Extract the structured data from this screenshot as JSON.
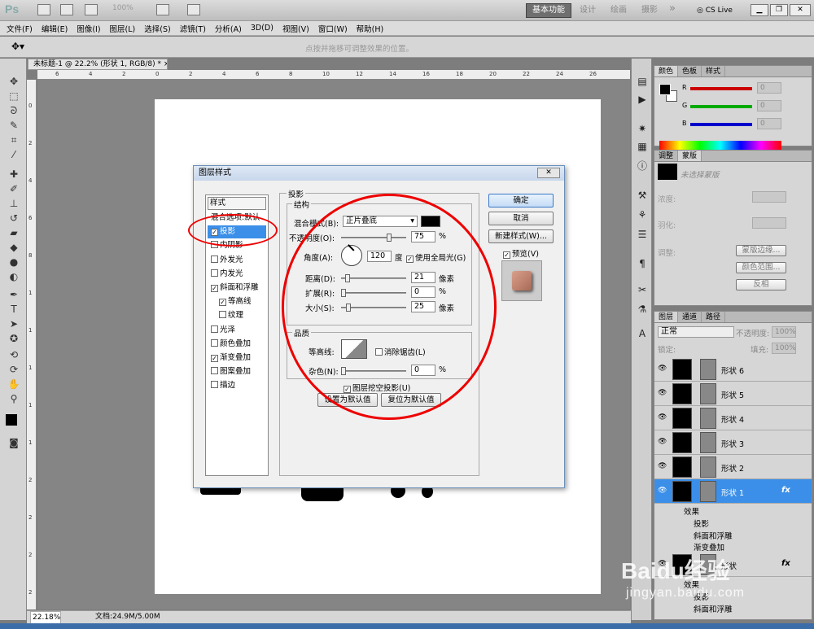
{
  "app": {
    "logo": "Ps",
    "zoom": "100%",
    "workspaces": [
      "基本功能",
      "设计",
      "绘画",
      "摄影"
    ],
    "more": "»",
    "cs_live": "CS Live"
  },
  "menu": [
    "文件(F)",
    "编辑(E)",
    "图像(I)",
    "图层(L)",
    "选择(S)",
    "滤镜(T)",
    "分析(A)",
    "3D(D)",
    "视图(V)",
    "窗口(W)",
    "帮助(H)"
  ],
  "options": {
    "hint": "点按并拖移可调整效果的位置。"
  },
  "doc_tab": "未标题-1 @ 22.2% (形状 1, RGB/8) *",
  "ruler_top": [
    "6",
    "4",
    "2",
    "0",
    "2",
    "4",
    "6",
    "8",
    "10",
    "12",
    "14",
    "16",
    "18",
    "20",
    "22",
    "24",
    "26"
  ],
  "ruler_left": [
    "0",
    "2",
    "4",
    "6",
    "8",
    "1",
    "1",
    "1",
    "1",
    "1",
    "2",
    "2",
    "2",
    "2"
  ],
  "status": {
    "zoom": "22.18%",
    "doc": "文档:24.9M/5.00M"
  },
  "color_panel": {
    "tabs": [
      "颜色",
      "色板",
      "样式"
    ],
    "r": "R",
    "g": "G",
    "b": "B",
    "r_val": "0",
    "g_val": "0",
    "b_val": "0"
  },
  "adjust_panel": {
    "tabs": [
      "调整",
      "蒙版"
    ],
    "mask_hint": "未选择蒙版",
    "density": "浓度:",
    "feather": "羽化:",
    "refine": "调整:",
    "btn_edge": "蒙版边缘...",
    "btn_range": "颜色范围...",
    "btn_invert": "反相"
  },
  "layers_panel": {
    "tabs": [
      "图层",
      "通道",
      "路径"
    ],
    "blend": "正常",
    "opacity_label": "不透明度:",
    "opacity": "100%",
    "lock": "锁定:",
    "fill_label": "填充:",
    "fill": "100%",
    "layers": [
      "形状 6",
      "形状 5",
      "形状 4",
      "形状 3",
      "形状 2",
      "形状 1"
    ],
    "fx": "fx",
    "effects_label": "效果",
    "effects": [
      "投影",
      "斜面和浮雕",
      "渐变叠加"
    ],
    "second_effects_label": "效果",
    "second_effects": [
      "投影",
      "斜面和浮雕"
    ],
    "second_layer": "形状"
  },
  "dialog": {
    "title": "图层样式",
    "styles_header": "样式",
    "styles": [
      {
        "label": "混合选项:默认",
        "check": false,
        "box": false
      },
      {
        "label": "投影",
        "check": true,
        "box": true
      },
      {
        "label": "内阴影",
        "check": false,
        "box": true
      },
      {
        "label": "外发光",
        "check": false,
        "box": true
      },
      {
        "label": "内发光",
        "check": false,
        "box": true
      },
      {
        "label": "斜面和浮雕",
        "check": true,
        "box": true
      },
      {
        "label": "等高线",
        "check": true,
        "box": true
      },
      {
        "label": "纹理",
        "check": false,
        "box": true
      },
      {
        "label": "光泽",
        "check": false,
        "box": true
      },
      {
        "label": "颜色叠加",
        "check": false,
        "box": true
      },
      {
        "label": "渐变叠加",
        "check": true,
        "box": true
      },
      {
        "label": "图案叠加",
        "check": false,
        "box": true
      },
      {
        "label": "描边",
        "check": false,
        "box": true
      }
    ],
    "section": "投影",
    "structure": "结构",
    "blend_mode_label": "混合模式(B):",
    "blend_mode": "正片叠底",
    "opacity_label": "不透明度(O):",
    "opacity": "75",
    "pct": "%",
    "angle_label": "角度(A):",
    "angle": "120",
    "deg": "度",
    "global_light": "使用全局光(G)",
    "distance_label": "距离(D):",
    "distance": "21",
    "spread_label": "扩展(R):",
    "spread": "0",
    "size_label": "大小(S):",
    "size": "25",
    "px": "像素",
    "quality": "品质",
    "contour_label": "等高线:",
    "antialias": "消除锯齿(L)",
    "noise_label": "杂色(N):",
    "noise": "0",
    "knockout": "图层挖空投影(U)",
    "set_default": "设置为默认值",
    "reset_default": "复位为默认值",
    "ok": "确定",
    "cancel": "取消",
    "new_style": "新建样式(W)...",
    "preview": "预览(V)",
    "sliders": {
      "opacity": 0.75,
      "distance": 0.07,
      "spread": 0.0,
      "size": 0.08,
      "noise": 0.0
    }
  },
  "watermark": {
    "brand": "Baidu经验",
    "url": "jingyan.baidu.com"
  }
}
